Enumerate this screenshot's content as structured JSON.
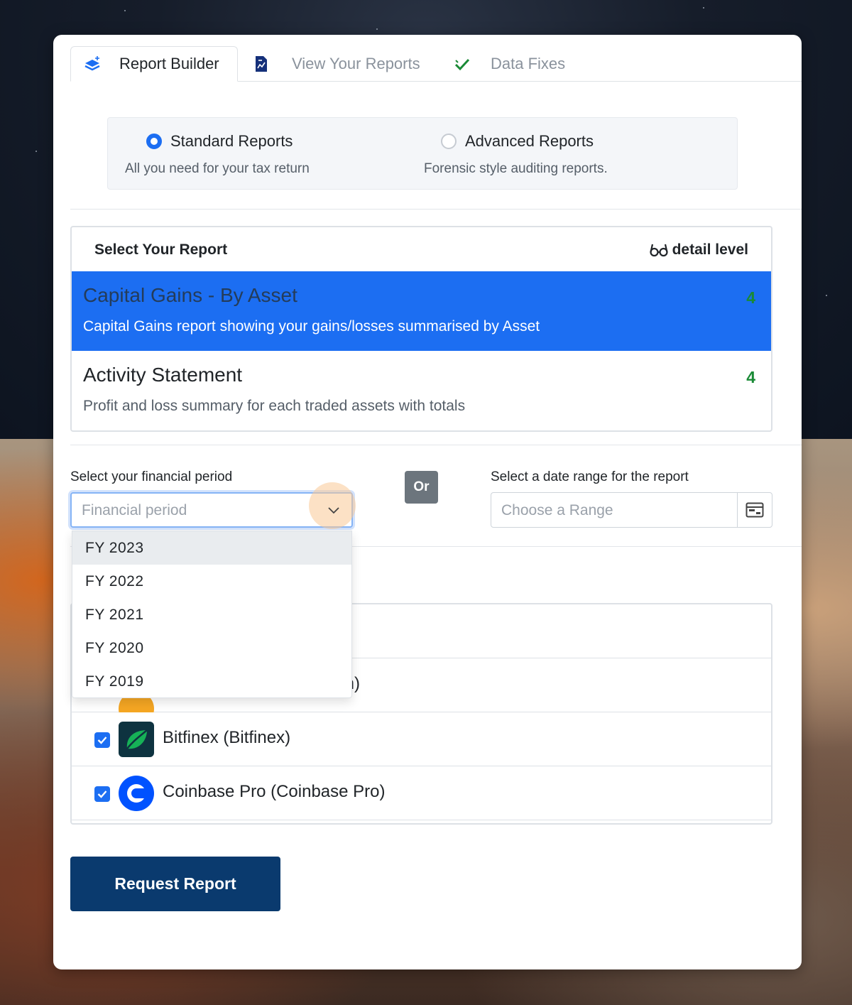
{
  "tabs": [
    {
      "label": "Report Builder",
      "icon": "layers-icon",
      "active": true
    },
    {
      "label": "View Your Reports",
      "icon": "document-icon",
      "active": false
    },
    {
      "label": "Data Fixes",
      "icon": "check-icon",
      "active": false
    }
  ],
  "report_types": {
    "standard": {
      "title": "Standard Reports",
      "desc": "All you need for your tax return",
      "selected": true
    },
    "advanced": {
      "title": "Advanced Reports",
      "desc": "Forensic style auditing reports.",
      "selected": false
    }
  },
  "report_list": {
    "title": "Select Your Report",
    "detail_label": "detail level",
    "items": [
      {
        "name": "Capital Gains - By Asset",
        "desc": "Capital Gains report showing your gains/losses summarised by Asset",
        "level": "4",
        "selected": true
      },
      {
        "name": "Activity Statement",
        "desc": "Profit and loss summary for each traded assets with totals",
        "level": "4",
        "selected": false
      }
    ]
  },
  "period": {
    "label": "Select your financial period",
    "placeholder": "Financial period",
    "options": [
      "FY 2023",
      "FY 2022",
      "FY 2021",
      "FY 2020",
      "FY 2019"
    ]
  },
  "or_label": "Or",
  "range": {
    "label": "Select a date range for the report",
    "placeholder": "Choose a Range"
  },
  "exchanges": [
    {
      "name": "ain)",
      "checked": true
    },
    {
      "name": "Bitfinex (Bitfinex)",
      "checked": true
    },
    {
      "name": "Coinbase Pro (Coinbase Pro)",
      "checked": true
    }
  ],
  "request_button": "Request Report",
  "colors": {
    "primary": "#1c6ef2",
    "navy": "#0a3a6e",
    "green": "#1a8a36",
    "bitfinex": "#16b157",
    "coinbase": "#0052ff"
  }
}
